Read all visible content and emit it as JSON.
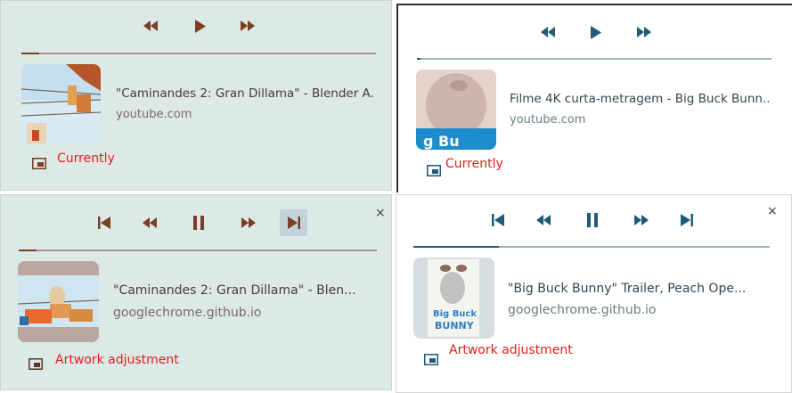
{
  "colors": {
    "panel_green": "#dde9e7",
    "brown_accent": "#7a3e22",
    "blue_accent": "#1e5b78",
    "dark_icon": "#3b4a54",
    "caption_red": "#e2201b"
  },
  "panels": [
    {
      "id": "top-left",
      "controls": [
        "seek-backward-icon",
        "play-icon",
        "seek-forward-icon"
      ],
      "progress": 0.05,
      "title": "\"Caminandes 2: Gran Dillama\" - Blender A...",
      "source": "youtube.com",
      "caption": "Currently"
    },
    {
      "id": "top-right",
      "controls": [
        "seek-backward-icon",
        "play-icon",
        "seek-forward-icon"
      ],
      "progress": 0.01,
      "title": "Filme 4K curta-metragem - Big Buck Bunn...",
      "source": "youtube.com",
      "caption": "Currently"
    },
    {
      "id": "bottom-left",
      "controls": [
        "previous-track-icon",
        "seek-backward-icon",
        "pause-icon",
        "seek-forward-icon",
        "next-track-icon"
      ],
      "progress": 0.05,
      "title": "\"Caminandes 2: Gran Dillama\" - Blen...",
      "source": "googlechrome.github.io",
      "caption": "Artwork adjustment",
      "close": "×"
    },
    {
      "id": "bottom-right",
      "controls": [
        "previous-track-icon",
        "seek-backward-icon",
        "pause-icon",
        "seek-forward-icon",
        "next-track-icon"
      ],
      "progress": 0.24,
      "title": "\"Big Buck Bunny\" Trailer, Peach Ope...",
      "source": "googlechrome.github.io",
      "caption": "Artwork adjustment",
      "close": "×"
    }
  ]
}
